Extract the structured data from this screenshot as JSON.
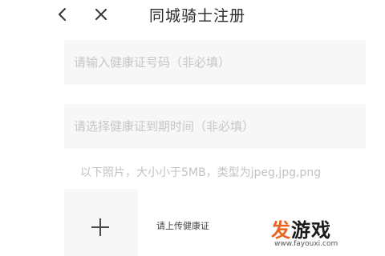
{
  "header": {
    "back_icon": "chevron-left-icon",
    "close_icon": "close-icon",
    "title": "同城骑士注册"
  },
  "form": {
    "cert_number_placeholder": "请输入健康证号码（非必填）",
    "cert_expiry_placeholder": "请选择健康证到期时间（非必填）",
    "photo_hint": "以下照片，大小小于5MB，类型为jpeg,jpg,png",
    "upload_icon": "plus-icon",
    "upload_label": "请上传健康证"
  },
  "watermark": {
    "logo_accent": "发",
    "logo_rest": "游戏",
    "url": "www.fayouxi.com"
  }
}
